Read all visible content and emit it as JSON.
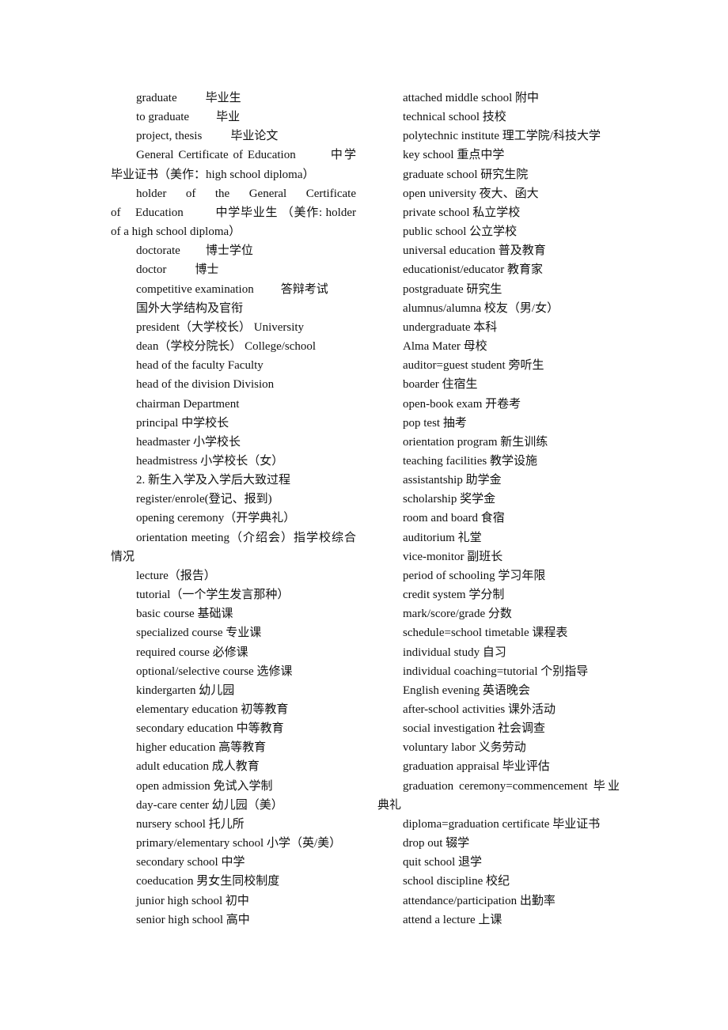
{
  "left_column": {
    "entries": [
      {
        "en": "graduate",
        "zh": "毕业生"
      },
      {
        "en": "to graduate",
        "zh": "毕业"
      },
      {
        "en": "project, thesis",
        "zh": "毕业论文"
      },
      {
        "en": "General Certificate of Education",
        "zh": "中学毕业证书（美作：high school diploma）"
      },
      {
        "en": "holder of the General Certificate of Education",
        "zh": "中学毕业生 （美作: holder of a high school diploma）"
      },
      {
        "en": "doctorate",
        "zh": "博士学位"
      },
      {
        "en": "doctor",
        "zh": "博士"
      },
      {
        "en": "competitive examination",
        "zh": "答辩考试"
      },
      {
        "text": "国外大学结构及官衔"
      },
      {
        "text": "president（大学校长） University"
      },
      {
        "text": "dean（学校分院长） College/school"
      },
      {
        "text": "head of the faculty Faculty"
      },
      {
        "text": "head of the division Division"
      },
      {
        "text": "chairman Department"
      },
      {
        "text": "principal 中学校长"
      },
      {
        "text": "headmaster 小学校长"
      },
      {
        "text": "headmistress 小学校长（女）"
      },
      {
        "text": "2. 新生入学及入学后大致过程"
      },
      {
        "text": "register/enrole(登记、报到)"
      },
      {
        "text": "opening ceremony（开学典礼）"
      },
      {
        "text": "orientation meeting（介绍会）指学校综合情况"
      },
      {
        "text": "lecture（报告）"
      },
      {
        "text": "tutorial（一个学生发言那种）"
      },
      {
        "text": "basic course 基础课"
      },
      {
        "text": "specialized course 专业课"
      },
      {
        "text": "required course 必修课"
      },
      {
        "text": "optional/selective course 选修课"
      },
      {
        "text": "kindergarten 幼儿园"
      },
      {
        "text": "elementary education 初等教育"
      },
      {
        "text": "secondary education 中等教育"
      },
      {
        "text": "higher education 高等教育"
      },
      {
        "text": "adult education 成人教育"
      },
      {
        "text": "open admission 免试入学制"
      },
      {
        "text": "day-care center 幼儿园（美）"
      },
      {
        "text": "nursery school 托儿所"
      },
      {
        "text": "primary/elementary school 小学（英/美）"
      },
      {
        "text": "secondary school 中学"
      },
      {
        "text": "coeducation 男女生同校制度"
      },
      {
        "text": "junior high school 初中"
      },
      {
        "text": "senior high school 高中"
      }
    ]
  },
  "right_column": {
    "entries": [
      {
        "text": "attached middle school 附中"
      },
      {
        "text": "technical school 技校"
      },
      {
        "text": "polytechnic institute 理工学院/科技大学"
      },
      {
        "text": "key school 重点中学"
      },
      {
        "text": "graduate school 研究生院"
      },
      {
        "text": "open university 夜大、函大"
      },
      {
        "text": "private school 私立学校"
      },
      {
        "text": "public school 公立学校"
      },
      {
        "text": "universal education 普及教育"
      },
      {
        "text": "educationist/educator 教育家"
      },
      {
        "text": "postgraduate 研究生"
      },
      {
        "text": "alumnus/alumna 校友（男/女）"
      },
      {
        "text": "undergraduate 本科"
      },
      {
        "text": "Alma Mater 母校"
      },
      {
        "text": "auditor=guest student 旁听生"
      },
      {
        "text": "boarder 住宿生"
      },
      {
        "text": "open-book exam 开卷考"
      },
      {
        "text": "pop test 抽考"
      },
      {
        "text": "orientation program 新生训练"
      },
      {
        "text": "teaching facilities 教学设施"
      },
      {
        "text": "assistantship 助学金"
      },
      {
        "text": "scholarship 奖学金"
      },
      {
        "text": "room and board 食宿"
      },
      {
        "text": "auditorium 礼堂"
      },
      {
        "text": "vice-monitor 副班长"
      },
      {
        "text": "period of schooling 学习年限"
      },
      {
        "text": "credit system 学分制"
      },
      {
        "text": "mark/score/grade 分数"
      },
      {
        "text": "schedule=school timetable 课程表"
      },
      {
        "text": "individual study 自习"
      },
      {
        "text": "individual coaching=tutorial 个别指导"
      },
      {
        "text": "English evening 英语晚会"
      },
      {
        "text": "after-school activities 课外活动"
      },
      {
        "text": "social investigation 社会调查"
      },
      {
        "text": "voluntary labor 义务劳动"
      },
      {
        "text": "graduation appraisal 毕业评估"
      },
      {
        "text": "graduation ceremony=commencement 毕业典礼"
      },
      {
        "text": "diploma=graduation certificate 毕业证书"
      },
      {
        "text": "drop out 辍学"
      },
      {
        "text": "quit school 退学"
      },
      {
        "text": "school discipline 校纪"
      },
      {
        "text": "attendance/participation 出勤率"
      },
      {
        "text": "attend a lecture 上课"
      }
    ]
  }
}
